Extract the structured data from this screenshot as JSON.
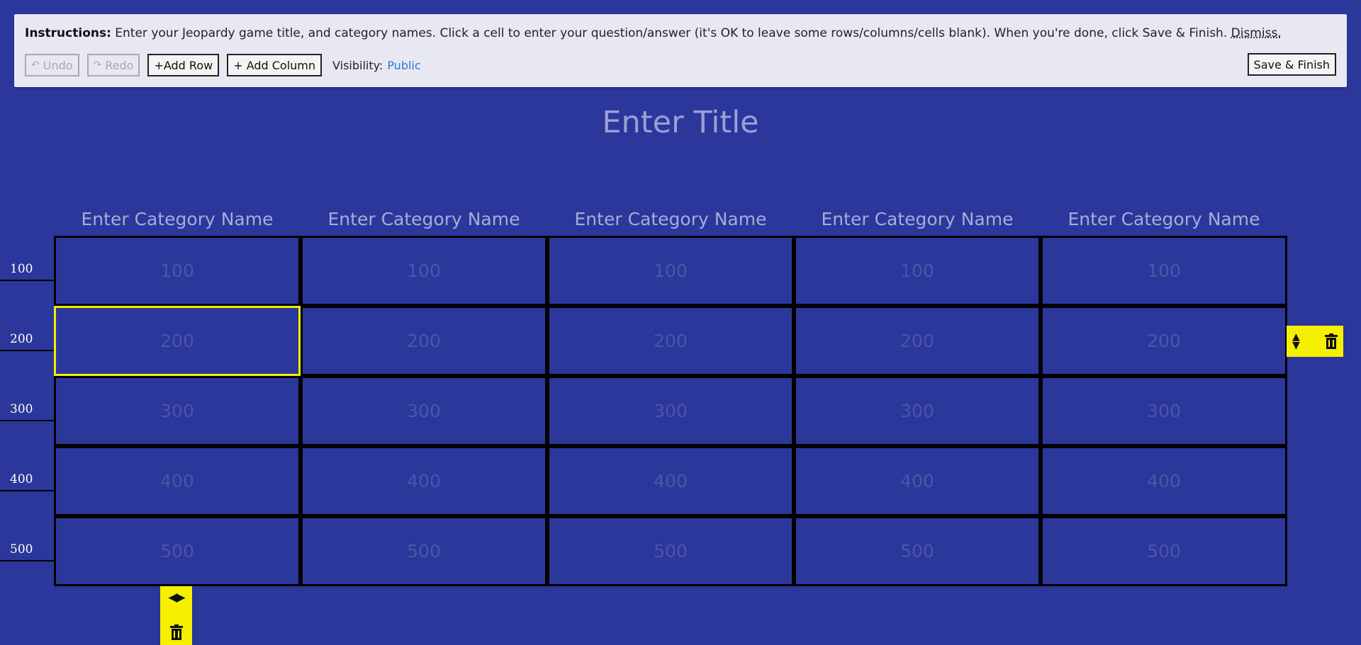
{
  "instructions": {
    "bold": "Instructions:",
    "text": " Enter your Jeopardy game title, and category names. Click a cell to enter your question/answer (it's OK to leave some rows/columns/cells blank). When you're done, click Save & Finish. ",
    "dismiss": "Dismiss."
  },
  "toolbar": {
    "undo": "Undo",
    "redo": "Redo",
    "add_row": "+Add Row",
    "add_column": "+ Add Column",
    "visibility_label": "Visibility:",
    "visibility_value": "Public",
    "save": "Save & Finish"
  },
  "title": "Enter Title",
  "categories": [
    "Enter Category Name",
    "Enter Category Name",
    "Enter Category Name",
    "Enter Category Name",
    "Enter Category Name"
  ],
  "rows": [
    "100",
    "200",
    "300",
    "400",
    "500"
  ],
  "selected_cell": {
    "row": 2,
    "column": 1
  },
  "colors": {
    "background": "#2b379a",
    "highlight": "#f5f000",
    "link": "#2a7ad6"
  }
}
